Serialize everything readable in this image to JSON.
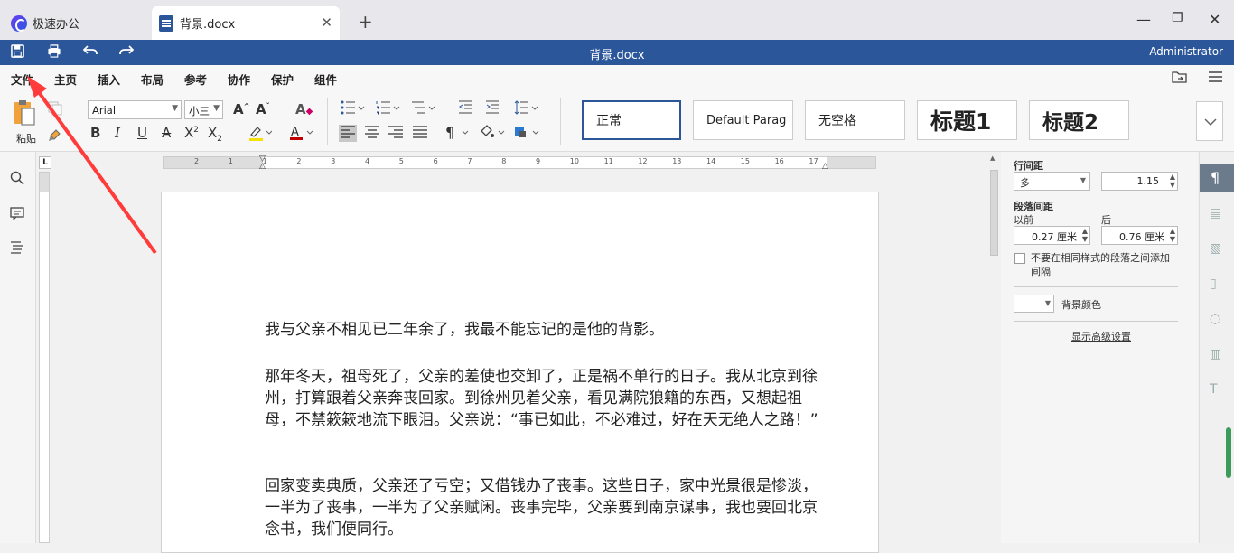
{
  "tabs": {
    "home_label": "极速办公",
    "doc_label": "背景.docx",
    "add": "+",
    "close": "✕"
  },
  "window": {
    "minimize": "—",
    "restore": "❐",
    "close": "✕"
  },
  "titlebar": {
    "title": "背景.docx",
    "user": "Administrator"
  },
  "menu": [
    "文件",
    "主页",
    "插入",
    "布局",
    "参考",
    "协作",
    "保护",
    "组件"
  ],
  "ribbon": {
    "paste_label": "粘贴",
    "font_name": "Arial",
    "font_size": "小三",
    "styles": [
      "正常",
      "Default Parag",
      "无空格",
      "标题1",
      "标题2"
    ]
  },
  "document": {
    "paragraphs": [
      "我与父亲不相见已二年余了，我最不能忘记的是他的背影。",
      "那年冬天，祖母死了，父亲的差使也交卸了，正是祸不单行的日子。我从北京到徐州，打算跟着父亲奔丧回家。到徐州见着父亲，看见满院狼籍的东西，又想起祖母，不禁簌簌地流下眼泪。父亲说：“事已如此，不必难过，好在天无绝人之路！”",
      "回家变卖典质，父亲还了亏空；又借钱办了丧事。这些日子，家中光景很是惨淡，一半为了丧事，一半为了父亲赋闲。丧事完毕，父亲要到南京谋事，我也要回北京念书，我们便同行。"
    ]
  },
  "panel": {
    "line_spacing_label": "行间距",
    "line_spacing_mode": "多",
    "line_spacing_value": "1.15",
    "para_spacing_label": "段落间距",
    "before_label": "以前",
    "after_label": "后",
    "before_value": "0.27 厘米",
    "after_value": "0.76 厘米",
    "no_space_checkbox": "不要在相同样式的段落之间添加间隔",
    "bg_color_label": "背景颜色",
    "advanced_link": "显示高级设置"
  },
  "ruler_numbers": [
    "2",
    "1",
    "1",
    "2",
    "3",
    "4",
    "5",
    "6",
    "7",
    "8",
    "9",
    "10",
    "11",
    "12",
    "13",
    "14",
    "15",
    "16",
    "17"
  ]
}
